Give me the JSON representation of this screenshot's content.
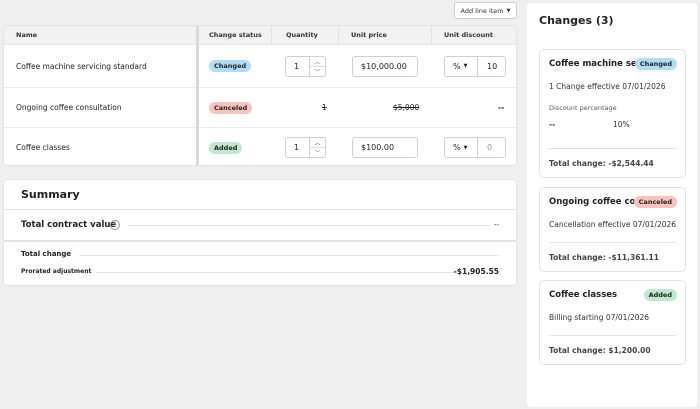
{
  "toolbar": {
    "add_line_item": "Add line item"
  },
  "table": {
    "headers": [
      "Name",
      "Change status",
      "Quantity",
      "Unit price",
      "Unit discount"
    ],
    "rows": [
      {
        "name": "Coffee machine servicing standard",
        "status": "Changed",
        "quantity": "1",
        "unit_price": "$10,000.00",
        "discount_type": "%",
        "discount": "10"
      },
      {
        "name": "Ongoing coffee consultation",
        "status": "Canceled",
        "quantity": "1",
        "unit_price": "$5,000",
        "discount": "--"
      },
      {
        "name": "Coffee classes",
        "status": "Added",
        "quantity": "1",
        "unit_price": "$100.00",
        "discount_type": "%",
        "discount": "0"
      }
    ]
  },
  "summary": {
    "title": "Summary",
    "total_contract_value_label": "Total contract value",
    "total_contract_value": "--",
    "total_change_label": "Total change",
    "prorated_label": "Prorated adjustment",
    "prorated_value": "-$1,905.55"
  },
  "changes": {
    "title": "Changes (3)",
    "cards": [
      {
        "title": "Coffee machine se...",
        "status": "Changed",
        "line1": "1 Change effective 07/01/2026",
        "field_label": "Discount percentage",
        "old_value": "--",
        "new_value": "10%",
        "total": "Total change: -$2,544.44"
      },
      {
        "title": "Ongoing coffee co...",
        "status": "Canceled",
        "line1": "Cancellation effective 07/01/2026",
        "total": "Total change: -$11,361.11"
      },
      {
        "title": "Coffee classes",
        "status": "Added",
        "line1": "Billing starting 07/01/2026",
        "total": "Total change: $1,200.00"
      }
    ]
  },
  "colors": {
    "changed": "#b0dcf5",
    "canceled": "#f9c2bd",
    "added": "#bfe8cc"
  }
}
